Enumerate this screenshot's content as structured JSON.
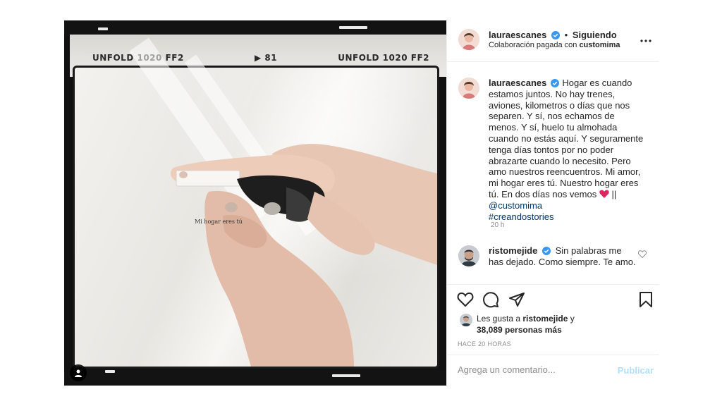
{
  "post": {
    "author": "lauraescanes",
    "follow_status": "Siguiendo",
    "partnership_prefix": "Colaboración pagada con",
    "partner": "customima",
    "film_label_left": "UNFOLD 1020 FF2",
    "film_label_center": "81",
    "film_label_right": "UNFOLD 1020 FF2",
    "tag_text": "Mi hogar eres tú"
  },
  "caption": {
    "author": "lauraescanes",
    "text": "Hogar es cuando estamos juntos. No hay trenes, aviones, kilometros o días que nos separen. Y sí, nos echamos de menos. Y sí, huelo tu almohada cuando no estás aquí. Y seguramente tenga días tontos por no poder abrazarte cuando lo necesito. Pero amo nuestros reencuentros. Mi amor, mi hogar eres tú. Nuestro hogar eres tú. En dos días nos vemos",
    "after_heart": " || ",
    "mention": "@customima",
    "hashtag": "#creandostories",
    "time": "20 h"
  },
  "comment": {
    "author": "ristomejide",
    "text": "Sin palabras me has dejado. Como siempre. Te amo."
  },
  "likes": {
    "prefix": "Les gusta a",
    "user": "ristomejide",
    "joiner": "y",
    "count_text": "38,089 personas más"
  },
  "post_time": "HACE 20 HORAS",
  "add_comment": {
    "placeholder": "Agrega un comentario...",
    "publish_label": "Publicar"
  },
  "colors": {
    "verified": "#3897f0",
    "link": "#00376b",
    "heart": "#e0245e",
    "publish_disabled": "#b2dffc"
  },
  "icons": {
    "verified": "verified-badge-icon",
    "more": "more-options-icon",
    "like": "heart-icon",
    "comment": "comment-bubble-icon",
    "share": "paper-plane-icon",
    "save": "bookmark-icon",
    "user_tag": "user-tag-icon"
  }
}
